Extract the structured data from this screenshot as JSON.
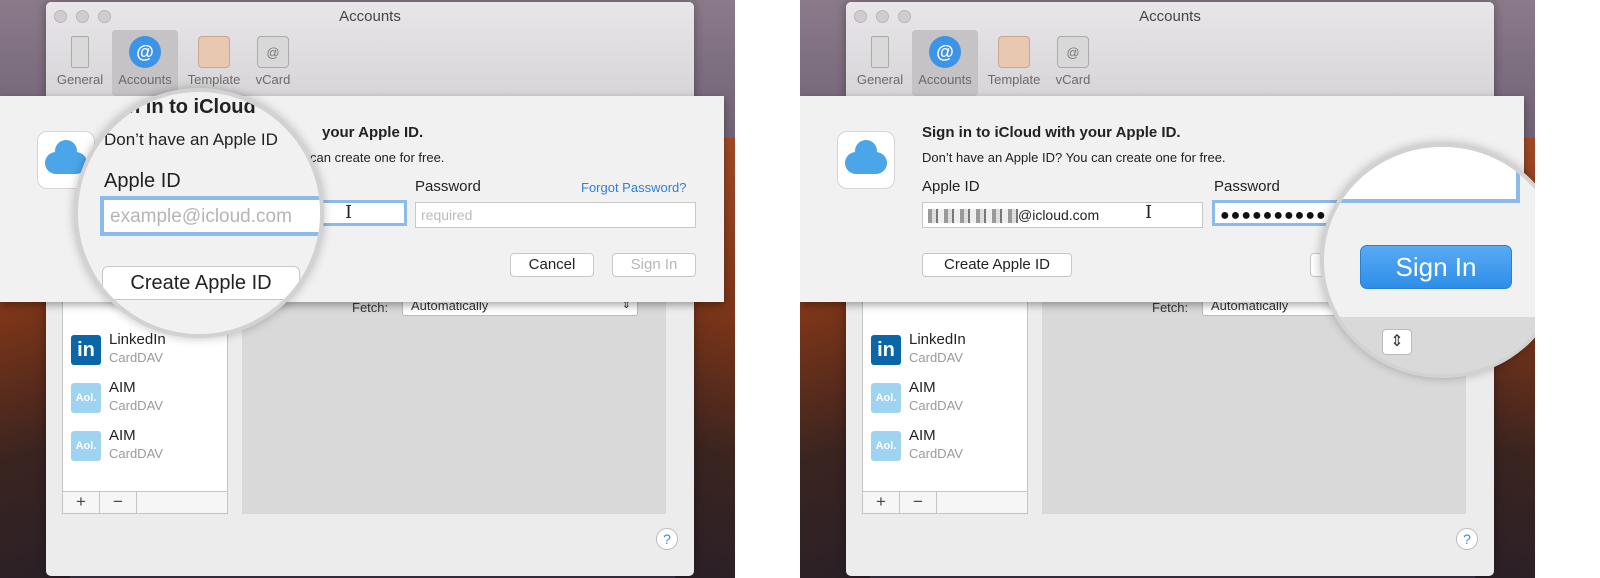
{
  "window": {
    "title": "Accounts"
  },
  "toolbar": {
    "general": "General",
    "accounts": "Accounts",
    "template": "Template",
    "vcard": "vCard"
  },
  "accounts_list": [
    {
      "name": "LinkedIn",
      "type": "CardDAV",
      "logo": "in"
    },
    {
      "name": "AIM",
      "type": "CardDAV",
      "logo": "Aol."
    },
    {
      "name": "AIM",
      "type": "CardDAV",
      "logo": "Aol."
    }
  ],
  "partial_account_type": "CardDAV",
  "list_buttons": {
    "add": "+",
    "remove": "−"
  },
  "fetch": {
    "label": "Fetch:",
    "value": "Automatically"
  },
  "help": "?",
  "signin_sheet": {
    "heading": "Sign in to iCloud with your Apple ID.",
    "subtext": "Don’t have an Apple ID? You can create one for free.",
    "apple_id_label": "Apple ID",
    "password_label": "Password",
    "forgot_password": "Forgot Password?",
    "apple_id_placeholder": "example@icloud.com",
    "password_placeholder": "required",
    "apple_id_value_suffix": "@icloud.com",
    "password_value": "●●●●●●●●●●",
    "create_button": "Create Apple ID",
    "cancel_button": "Cancel",
    "signin_button": "Sign In"
  },
  "magnifier_left": {
    "heading_fragment": "n in to iCloud",
    "subtext_fragment": "Don’t have an Apple ID",
    "heading_rest": "your Apple ID.",
    "subtext_rest": "can create one for free."
  },
  "magnifier_right": {
    "cancel_fragment": "C"
  },
  "colors": {
    "accent": "#3d93e6",
    "link": "#2f7ed8",
    "signin_blue": "#2d8ee8"
  }
}
